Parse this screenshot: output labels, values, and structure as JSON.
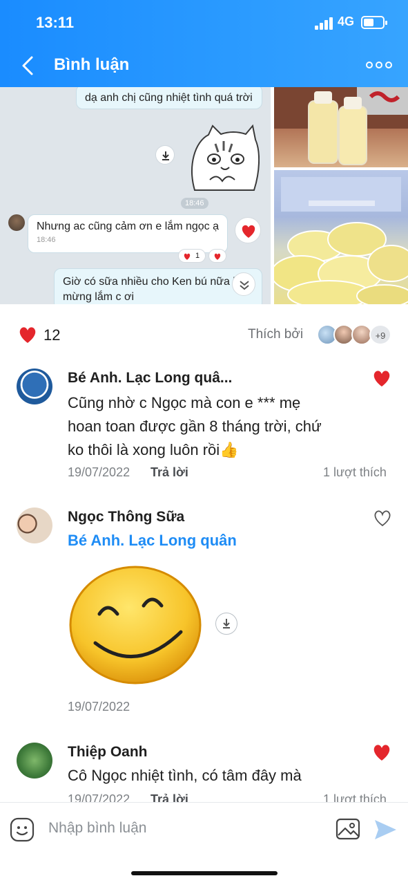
{
  "status_bar": {
    "time": "13:11",
    "network": "4G"
  },
  "header": {
    "title": "Bình luận"
  },
  "post_images": {
    "chat": {
      "bubble_top": "dạ anh chị cũng nhiệt tình quá trời",
      "time_pill": "18:46",
      "bubble_mid": "Nhưng ac cũng cảm ơn e lắm ngọc ạ",
      "bubble_mid_time": "18:46",
      "reaction_count": "1",
      "bubble_bottom_line1": "Giờ có sữa nhiều cho Ken bú nữa là",
      "bubble_bottom_line2": "mừng lắm c ơi"
    }
  },
  "reactions": {
    "count": "12",
    "liked_by_label": "Thích bởi",
    "more_count": "+9",
    "heart_color": "#e4262c"
  },
  "comments": [
    {
      "name": "Bé Anh. Lạc Long quâ...",
      "text_lines": [
        "Cũng nhờ c Ngọc mà con e *** mẹ",
        "hoan toan được gần 8 tháng trời, chứ",
        "ko thôi là xong luôn rồi👍"
      ],
      "date": "19/07/2022",
      "reply": "Trả lời",
      "likes": "1 lượt thích",
      "liked": true
    },
    {
      "name": "Ngọc Thông Sữa",
      "mention": "Bé Anh. Lạc Long quân",
      "date": "19/07/2022",
      "liked": false
    },
    {
      "name": "Thiệp Oanh",
      "text_lines": [
        "Cô Ngọc nhiệt tình, có tâm đây mà"
      ],
      "date": "19/07/2022",
      "reply": "Trả lời",
      "likes": "1 lượt thích",
      "liked": true
    }
  ],
  "input": {
    "placeholder": "Nhập bình luận"
  },
  "colors": {
    "header": "#2b9bff",
    "accent": "#1e8cf5",
    "heart": "#e4262c"
  }
}
